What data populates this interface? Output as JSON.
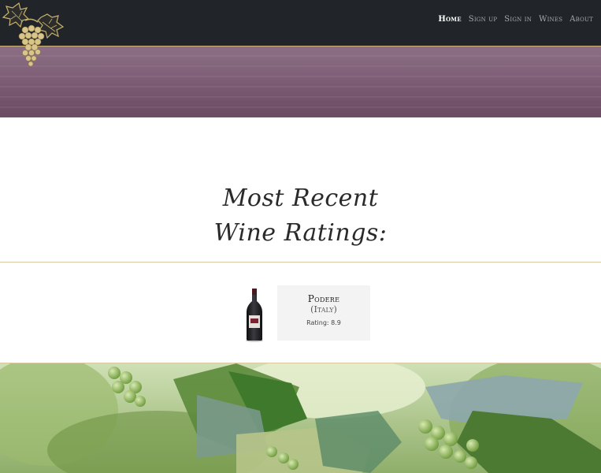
{
  "nav": {
    "items": [
      {
        "label": "Home",
        "active": true
      },
      {
        "label": "Sign up",
        "active": false
      },
      {
        "label": "Sign in",
        "active": false
      },
      {
        "label": "Wines",
        "active": false
      },
      {
        "label": "About",
        "active": false
      }
    ]
  },
  "logo": {
    "icon": "grape-cluster-icon"
  },
  "heading": {
    "line1": "Most Recent",
    "line2": "Wine Ratings:"
  },
  "ratings": [
    {
      "name": "Podere",
      "country": "(Italy)",
      "rating": "Rating: 8.9",
      "image": "wine-bottle-icon"
    }
  ],
  "colors": {
    "nav_bg": "#212428",
    "banner": "#7a5a73",
    "gold_rule": "#cdb57a",
    "card_bg": "#f3f3f3"
  }
}
